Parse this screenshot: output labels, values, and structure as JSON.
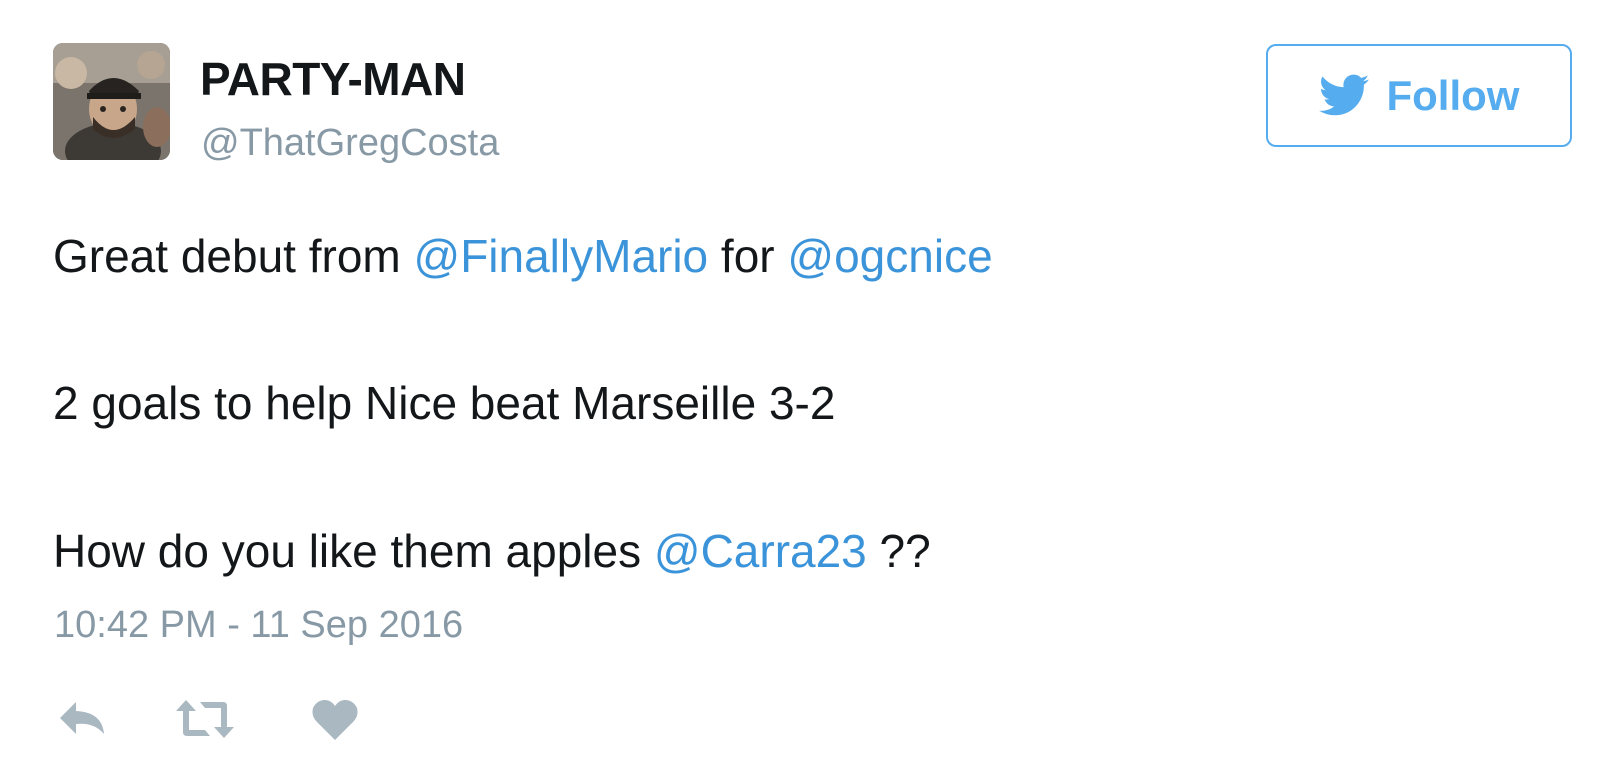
{
  "user": {
    "display_name": "PARTY-MAN",
    "handle": "@ThatGregCosta",
    "avatar_icon": "profile-photo"
  },
  "follow_button": {
    "label": "Follow",
    "icon": "twitter-bird-icon",
    "color": "#55acee"
  },
  "tweet": {
    "line1": {
      "text_before": "Great debut from ",
      "mention1": "@FinallyMario",
      "text_middle": " for ",
      "mention2": "@ogcnice"
    },
    "line2": {
      "text": "2 goals to help Nice beat Marseille 3-2"
    },
    "line3": {
      "text_before": "How do you like them apples ",
      "mention": "@Carra23",
      "text_after": " ??"
    },
    "timestamp": "10:42 PM - 11 Sep 2016"
  },
  "actions": {
    "reply_icon": "reply-icon",
    "retweet_icon": "retweet-icon",
    "like_icon": "heart-icon"
  },
  "colors": {
    "text": "#14171a",
    "secondary": "#8899a6",
    "link": "#3b94d9",
    "icon": "#aab8c2"
  }
}
